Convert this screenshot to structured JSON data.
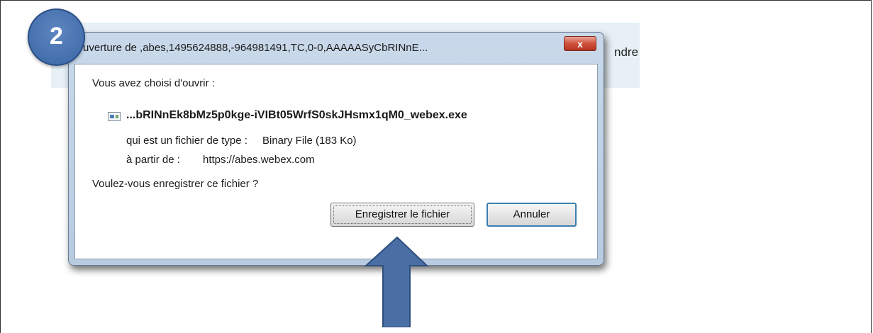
{
  "background": {
    "partial_text": "ndre"
  },
  "step_badge": {
    "number": "2"
  },
  "dialog": {
    "title": "uverture de ,abes,1495624888,-964981491,TC,0-0,AAAAASyCbRINnE...",
    "close_label": "x",
    "intro": "Vous avez choisi d'ouvrir :",
    "file_name": "...bRINnEk8bMz5p0kge-iVIBt05WrfS0skJHsmx1qM0_webex.exe",
    "type_label": "qui est un fichier de type :",
    "type_value": "Binary File (183 Ko)",
    "from_label": "à partir de :",
    "from_value": "https://abes.webex.com",
    "question": "Voulez-vous enregistrer ce fichier ?",
    "save_button": "Enregistrer le fichier",
    "cancel_button": "Annuler"
  },
  "colors": {
    "badge": "#4470ad",
    "arrow": "#4a6fa5",
    "close_button": "#c9442e",
    "cancel_focus": "#3c7fb1"
  },
  "icons": {
    "step_badge": "numbered-circle",
    "arrow": "up-arrow-icon",
    "file": "executable-file-icon",
    "close": "close-icon"
  }
}
